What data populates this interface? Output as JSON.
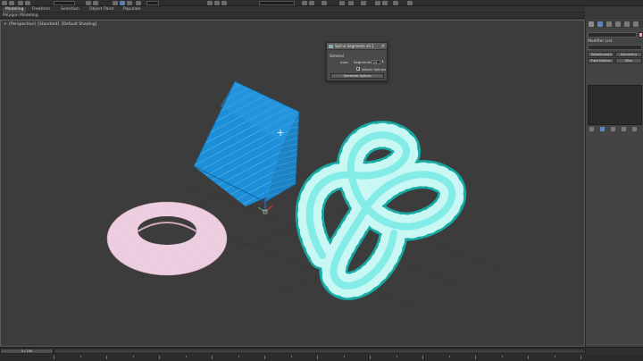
{
  "ribbon": {
    "tabs": [
      {
        "label": "Modeling",
        "active": true
      },
      {
        "label": "Freeform",
        "active": false
      },
      {
        "label": "Selection",
        "active": false
      },
      {
        "label": "Object Paint",
        "active": false
      },
      {
        "label": "Populate",
        "active": false
      }
    ],
    "sub_label": "Polygon Modeling"
  },
  "viewport": {
    "label_parts": [
      "+",
      "[Perspective]",
      "[Standard]",
      "[Default Shading]"
    ],
    "objects": [
      {
        "name": "box",
        "color": "#1e8fd6"
      },
      {
        "name": "torus",
        "color": "#e8c4da"
      },
      {
        "name": "torus-knot",
        "color": "#26c8c0"
      }
    ]
  },
  "dialog": {
    "title": "Spline Segments v0.1",
    "group_label": "General",
    "auto_label": "Auto",
    "segments_label": "Segments:",
    "segments_value": "24",
    "attach_checked": true,
    "attach_label": "Attach Splines",
    "generate_button": "Generate Splines"
  },
  "command_panel": {
    "modifier_list_label": "Modifier List",
    "buttons": [
      "TurboSmooth",
      "Symmetry",
      "Push Deform",
      "Slice"
    ],
    "color_swatch": "#e7a3c9"
  },
  "timeline": {
    "frame_label": "0 / 100"
  }
}
